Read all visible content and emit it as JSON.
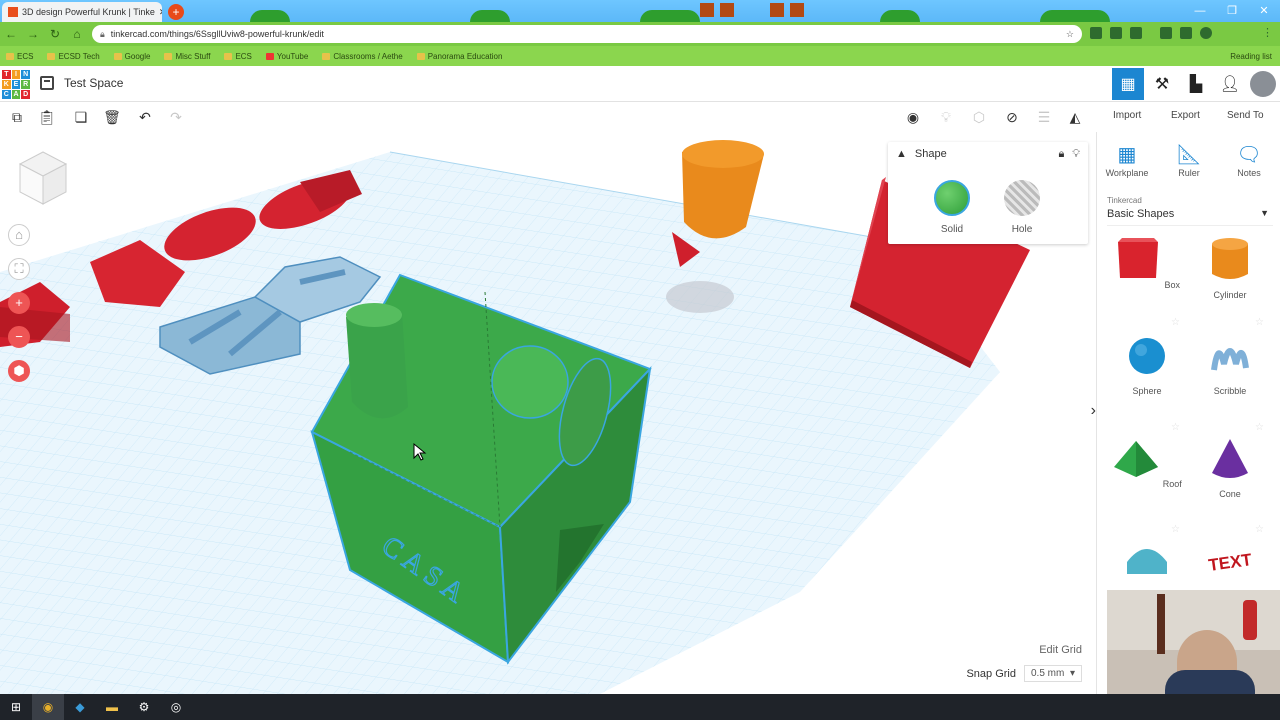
{
  "browser": {
    "tab_title": "3D design Powerful Krunk | Tinke",
    "url": "tinkercad.com/things/6SsgllUviw8-powerful-krunk/edit",
    "bookmarks": [
      "ECS",
      "ECSD Tech",
      "Google",
      "Misc Stuff",
      "ECS",
      "YouTube",
      "Classrooms / Aethe",
      "Panorama Education"
    ],
    "reading_list": "Reading list"
  },
  "app": {
    "logo_letters": [
      "T",
      "I",
      "N",
      "K",
      "E",
      "R",
      "C",
      "A",
      "D"
    ],
    "design_title": "Test Space"
  },
  "toolbar": {
    "import_label": "Import",
    "export_label": "Export",
    "send_to_label": "Send To"
  },
  "inspector": {
    "title": "Shape",
    "solid_label": "Solid",
    "hole_label": "Hole"
  },
  "workplane": {
    "edit_grid_label": "Edit Grid",
    "snap_grid_label": "Snap Grid",
    "snap_grid_value": "0.5 mm",
    "text_on_box": "CASA"
  },
  "panel": {
    "workplane_label": "Workplane",
    "ruler_label": "Ruler",
    "notes_label": "Notes",
    "library_provider": "Tinkercad",
    "library_name": "Basic Shapes",
    "shapes": [
      {
        "name": "Box",
        "color": "#d9232d"
      },
      {
        "name": "Cylinder",
        "color": "#e98a1c"
      },
      {
        "name": "Sphere",
        "color": "#1a8fd0"
      },
      {
        "name": "Scribble",
        "color": "#7fb0d8"
      },
      {
        "name": "Roof",
        "color": "#2fa84a"
      },
      {
        "name": "Cone",
        "color": "#6a2fa0"
      },
      {
        "name": "",
        "color": "#4fb3c9"
      },
      {
        "name": "",
        "color": "#c0161e"
      }
    ],
    "text_shape_label": "TEXT"
  },
  "colors": {
    "accent": "#1c86d1",
    "solid": "#3fb54a",
    "workplane_grid": "#bfe3f5",
    "selection": "#3aa6e0"
  }
}
